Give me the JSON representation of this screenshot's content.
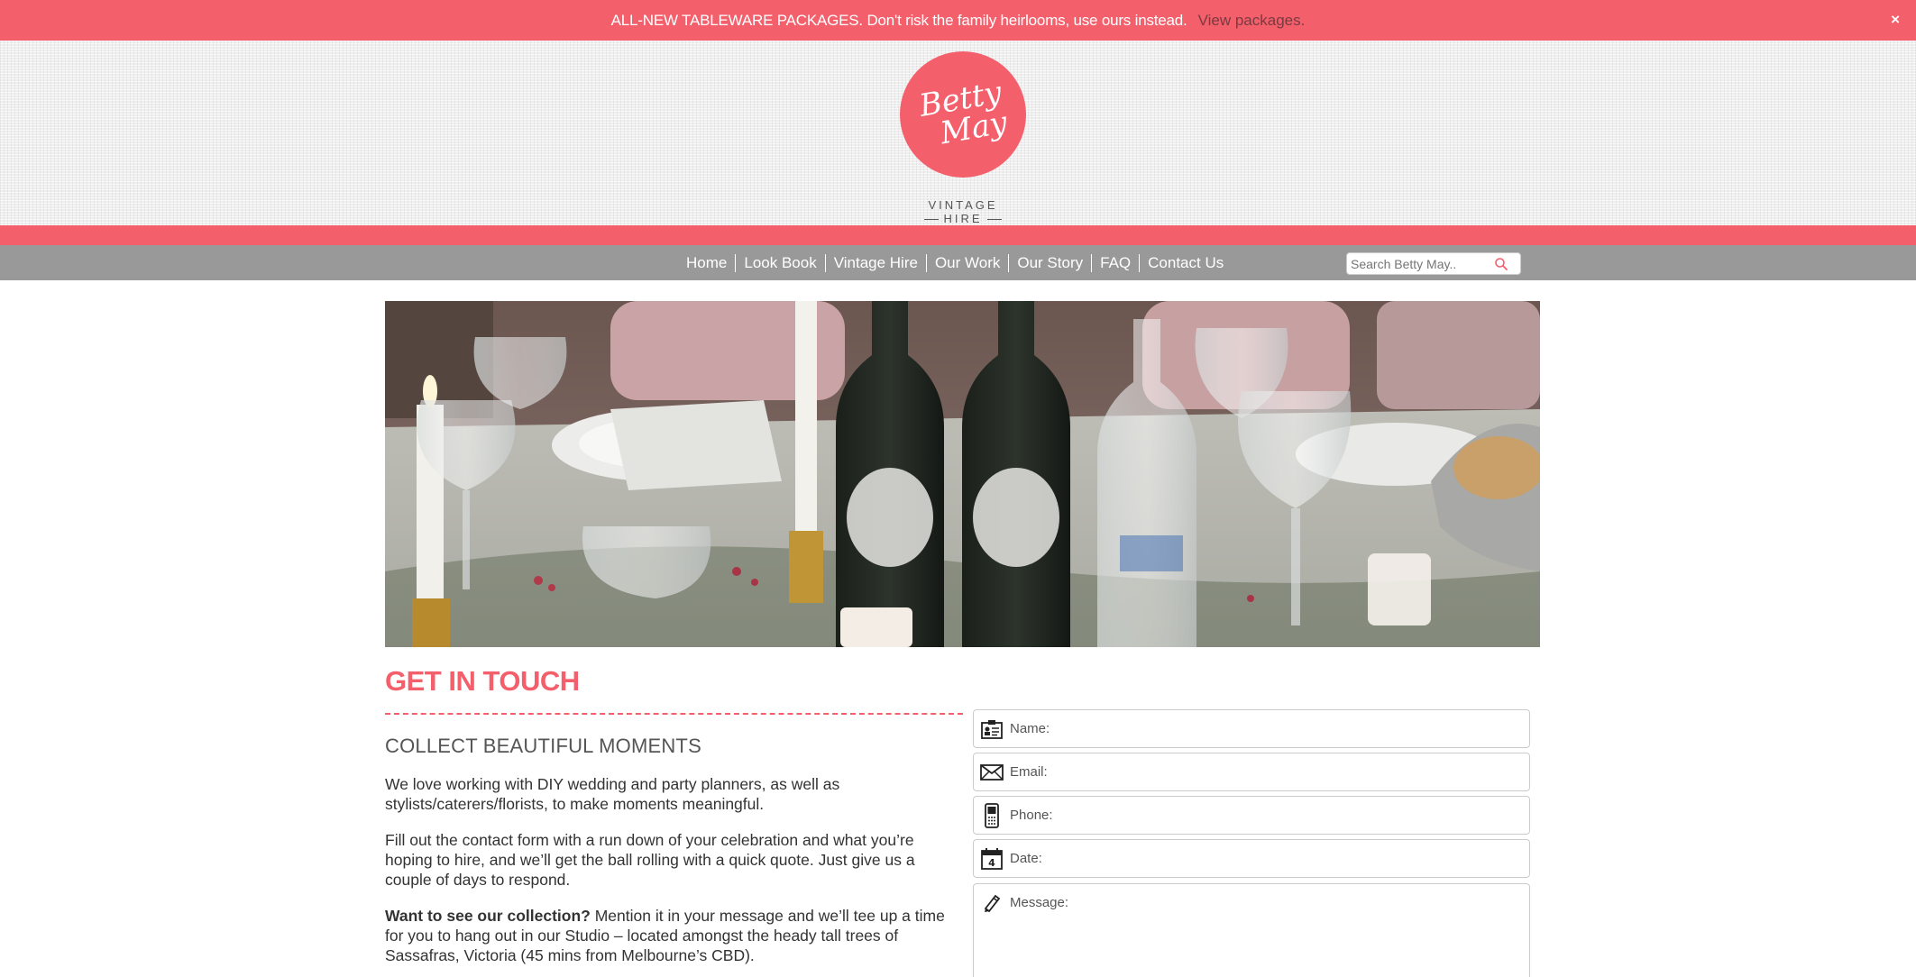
{
  "banner": {
    "text": "ALL-NEW TABLEWARE PACKAGES. Don't risk the family heirlooms, use ours instead.",
    "link": "View packages.",
    "close": "×"
  },
  "logo": {
    "script_line1": "Betty",
    "script_line2": "May",
    "sub_line1": "VINTAGE",
    "sub_line2": "HIRE"
  },
  "nav": {
    "items": [
      {
        "label": "Home"
      },
      {
        "label": "Look Book"
      },
      {
        "label": "Vintage Hire"
      },
      {
        "label": "Our Work"
      },
      {
        "label": "Our Story"
      },
      {
        "label": "FAQ"
      },
      {
        "label": "Contact Us"
      }
    ]
  },
  "search": {
    "placeholder": "Search Betty May.."
  },
  "content": {
    "title": "GET IN TOUCH",
    "subtitle": "COLLECT BEAUTIFUL MOMENTS",
    "p1": "We love working with DIY wedding and party planners, as well as stylists/caterers/florists, to make moments meaningful.",
    "p2": "Fill out the contact form with a run down of your celebration and what you’re hoping to hire, and we’ll get the ball rolling with a quick quote. Just give us a couple of days to respond.",
    "p3_bold": "Want to see our collection?",
    "p3_rest": " Mention it in your message and we’ll tee up a time for you to hang out in our Studio – located amongst the heady tall trees of Sassafras, Victoria (45 mins from Melbourne’s CBD)."
  },
  "form": {
    "name_label": "Name:",
    "email_label": "Email:",
    "phone_label": "Phone:",
    "date_label": "Date:",
    "message_label": "Message:",
    "calendar_day": "4"
  },
  "colors": {
    "brand_pink": "#f45f6c",
    "nav_gray": "#999999"
  }
}
